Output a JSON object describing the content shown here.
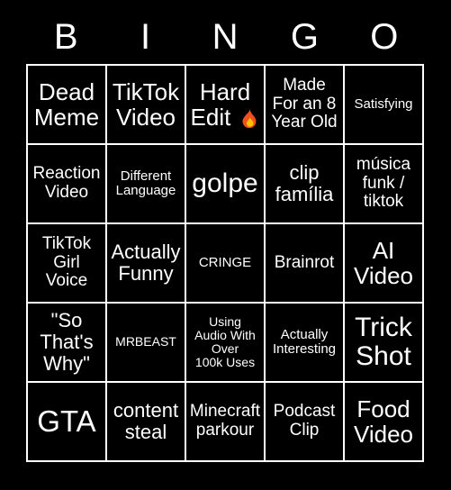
{
  "card": {
    "title": "BINGO",
    "header_letters": [
      "B",
      "I",
      "N",
      "G",
      "O"
    ],
    "colors": {
      "background": "#000000",
      "grid_line": "#ffffff",
      "cell_background": "#000000",
      "text": "#ffffff",
      "flame_outer": "#f4501e",
      "flame_inner": "#ffc400"
    },
    "rows": [
      [
        {
          "text": "Dead\nMeme",
          "size": "lg",
          "icon": ""
        },
        {
          "text": "TikTok\nVideo",
          "size": "lg",
          "icon": ""
        },
        {
          "text": "Hard\nEdit ",
          "size": "lg",
          "icon": "fire-emoji"
        },
        {
          "text": "Made\nFor an 8\nYear Old",
          "size": "sm",
          "icon": ""
        },
        {
          "text": "Satisfying",
          "size": "xs",
          "icon": ""
        }
      ],
      [
        {
          "text": "Reaction\nVideo",
          "size": "sm",
          "icon": ""
        },
        {
          "text": "Different\nLanguage",
          "size": "xs",
          "icon": ""
        },
        {
          "text": "golpe",
          "size": "xl",
          "icon": ""
        },
        {
          "text": "clip\nfamília",
          "size": "md",
          "icon": ""
        },
        {
          "text": "música\nfunk /\ntiktok",
          "size": "sm",
          "icon": ""
        }
      ],
      [
        {
          "text": "TikTok\nGirl\nVoice",
          "size": "sm",
          "icon": ""
        },
        {
          "text": "Actually\nFunny",
          "size": "md",
          "icon": ""
        },
        {
          "text": "CRINGE",
          "size": "xs",
          "icon": ""
        },
        {
          "text": "Brainrot",
          "size": "sm",
          "icon": ""
        },
        {
          "text": "AI\nVideo",
          "size": "lg",
          "icon": ""
        }
      ],
      [
        {
          "text": "\"So\nThat's\nWhy\"",
          "size": "md",
          "icon": ""
        },
        {
          "text": "MRBEAST",
          "size": "xxs",
          "icon": ""
        },
        {
          "text": "Using\nAudio With\nOver\n100k Uses",
          "size": "xxs",
          "icon": ""
        },
        {
          "text": "Actually\nInteresting",
          "size": "xs",
          "icon": ""
        },
        {
          "text": "Trick\nShot",
          "size": "xl",
          "icon": ""
        }
      ],
      [
        {
          "text": "GTA",
          "size": "xxl",
          "icon": ""
        },
        {
          "text": "content\nsteal",
          "size": "md",
          "icon": ""
        },
        {
          "text": "Minecraft\nparkour",
          "size": "sm",
          "icon": ""
        },
        {
          "text": "Podcast\nClip",
          "size": "sm",
          "icon": ""
        },
        {
          "text": "Food\nVideo",
          "size": "lg",
          "icon": ""
        }
      ]
    ]
  }
}
